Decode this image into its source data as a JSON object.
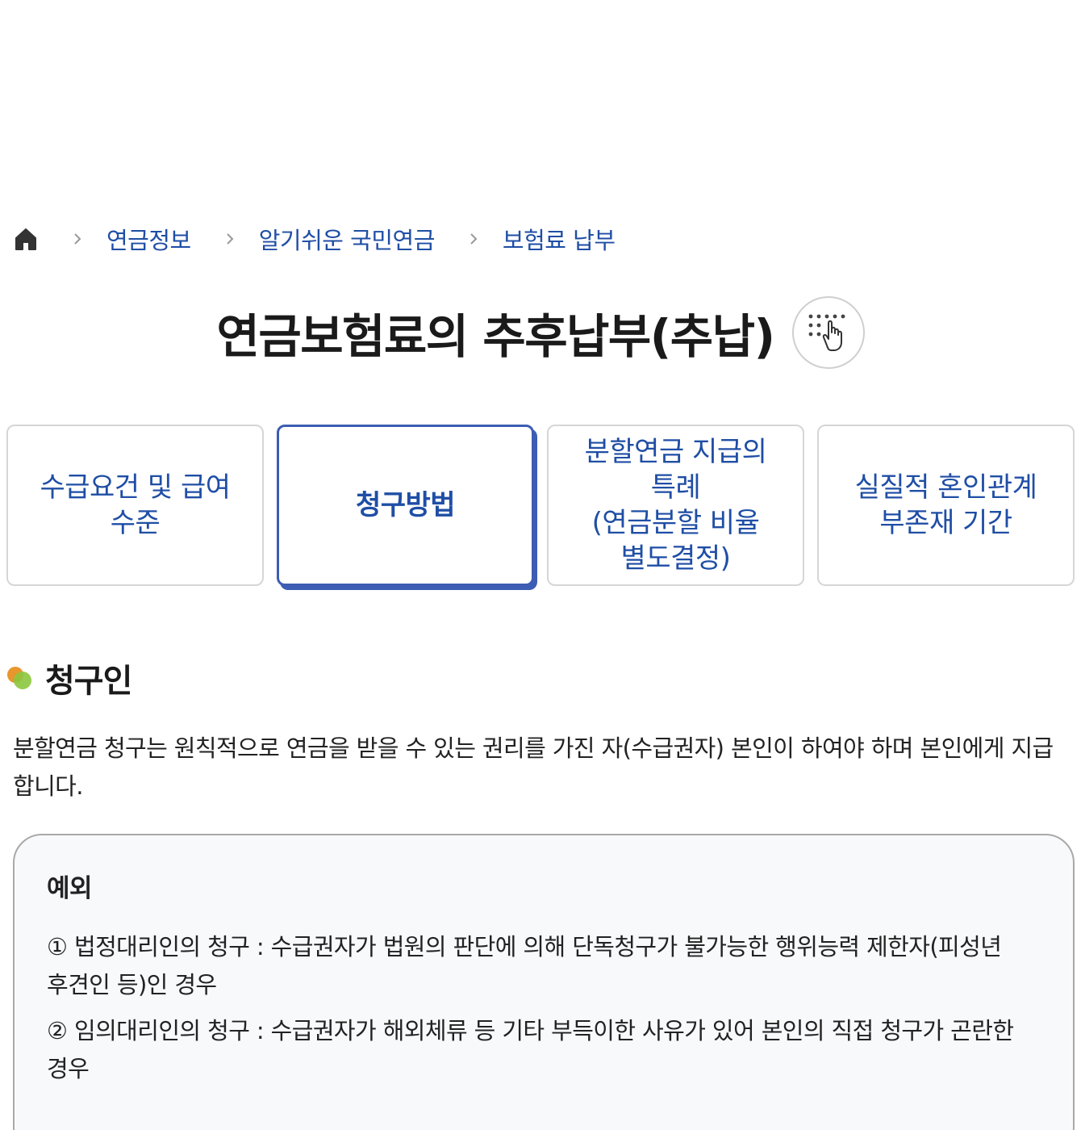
{
  "breadcrumb": {
    "home_icon": "home-icon",
    "separator_icon": "chevron-right-icon",
    "items": [
      "연금정보",
      "알기쉬운 국민연금",
      "보험료 납부"
    ]
  },
  "page": {
    "title": "연금보험료의 추후납부(추납)",
    "touch_button_icon": "touch-hand-icon"
  },
  "tabs": [
    {
      "label": "수급요건 및 급여\n수준",
      "active": false
    },
    {
      "label": "청구방법",
      "active": true
    },
    {
      "label": "분할연금 지급의\n특례\n(연금분할 비율\n별도결정)",
      "active": false
    },
    {
      "label": "실질적 혼인관계\n부존재 기간",
      "active": false
    }
  ],
  "section": {
    "bullet_icon": "section-bullet-icon",
    "title": "청구인",
    "body": "분할연금 청구는 원칙적으로 연금을 받을 수 있는 권리를 가진 자(수급권자) 본인이 하여야 하며 본인에게 지급합니다."
  },
  "exception": {
    "title": "예외",
    "items": [
      "① 법정대리인의 청구 : 수급권자가 법원의 판단에 의해 단독청구가 불가능한 행위능력 제한자(피성년후견인 등)인 경우",
      "② 임의대리인의 청구 : 수급권자가 해외체류 등 기타 부득이한 사유가 있어 본인의 직접 청구가 곤란한 경우"
    ]
  },
  "colors": {
    "link_blue": "#1f4ea5",
    "active_tab_border": "#3c5db3",
    "bullet_orange": "#e8962e",
    "bullet_green": "#8cc63f"
  }
}
